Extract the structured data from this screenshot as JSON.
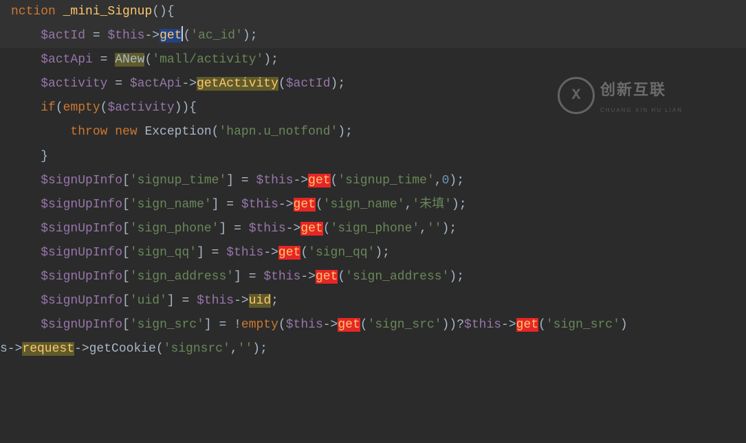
{
  "watermark": {
    "brand": "创新互联",
    "sub": "CHUANG XIN HU LIAN",
    "logoLetter": "X"
  },
  "code": {
    "line0_pre": "nction ",
    "line0_fn": "_mini_Signup",
    "line0_post": "(){",
    "l1_a": "    ",
    "l1_var": "$actId",
    "l1_b": " = ",
    "l1_this": "$this",
    "l1_c": "->",
    "l1_get": "get",
    "l1_d": "(",
    "l1_str": "'ac_id'",
    "l1_e": ");",
    "l2_a": "    ",
    "l2_var": "$actApi",
    "l2_b": " = ",
    "l2_new": "ANew",
    "l2_c": "(",
    "l2_str": "'mall/activity'",
    "l2_d": ");",
    "blank": "",
    "l4_a": "    ",
    "l4_var": "$activity",
    "l4_b": " = ",
    "l4_api": "$actApi",
    "l4_c": "->",
    "l4_meth": "getActivity",
    "l4_d": "(",
    "l4_arg": "$actId",
    "l4_e": ");",
    "l5_a": "    ",
    "l5_if": "if",
    "l5_b": "(",
    "l5_emp": "empty",
    "l5_c": "(",
    "l5_var": "$activity",
    "l5_d": ")){",
    "l6_a": "        ",
    "l6_throw": "throw ",
    "l6_new": "new ",
    "l6_ex": "Exception(",
    "l6_str": "'hapn.u_notfond'",
    "l6_e": ");",
    "l7_a": "    }",
    "l9_a": "    ",
    "l9_v": "$signUpInfo",
    "l9_b": "[",
    "l9_k": "'signup_time'",
    "l9_c": "] = ",
    "l9_t": "$this",
    "l9_d": "->",
    "l9_g": "get",
    "l9_e": "(",
    "l9_s": "'signup_time'",
    "l9_f": ",",
    "l9_n": "0",
    "l9_h": ");",
    "l10_a": "    ",
    "l10_v": "$signUpInfo",
    "l10_b": "[",
    "l10_k": "'sign_name'",
    "l10_c": "] = ",
    "l10_t": "$this",
    "l10_d": "->",
    "l10_g": "get",
    "l10_e": "(",
    "l10_s": "'sign_name'",
    "l10_f": ",",
    "l10_s2": "'未填'",
    "l10_h": ");",
    "l11_a": "    ",
    "l11_v": "$signUpInfo",
    "l11_b": "[",
    "l11_k": "'sign_phone'",
    "l11_c": "] = ",
    "l11_t": "$this",
    "l11_d": "->",
    "l11_g": "get",
    "l11_e": "(",
    "l11_s": "'sign_phone'",
    "l11_f": ",",
    "l11_s2": "''",
    "l11_h": ");",
    "l12_a": "    ",
    "l12_v": "$signUpInfo",
    "l12_b": "[",
    "l12_k": "'sign_qq'",
    "l12_c": "] = ",
    "l12_t": "$this",
    "l12_d": "->",
    "l12_g": "get",
    "l12_e": "(",
    "l12_s": "'sign_qq'",
    "l12_h": ");",
    "l13_a": "    ",
    "l13_v": "$signUpInfo",
    "l13_b": "[",
    "l13_k": "'sign_address'",
    "l13_c": "] = ",
    "l13_t": "$this",
    "l13_d": "->",
    "l13_g": "get",
    "l13_e": "(",
    "l13_s": "'sign_address'",
    "l13_h": ");",
    "l14_a": "    ",
    "l14_v": "$signUpInfo",
    "l14_b": "[",
    "l14_k": "'uid'",
    "l14_c": "] = ",
    "l14_t": "$this",
    "l14_d": "->",
    "l14_u": "uid",
    "l14_e": ";",
    "l15_a": "    ",
    "l15_v": "$signUpInfo",
    "l15_b": "[",
    "l15_k": "'sign_src'",
    "l15_c": "] = !",
    "l15_emp": "empty",
    "l15_d": "(",
    "l15_t1": "$this",
    "l15_e": "->",
    "l15_g1": "get",
    "l15_f": "(",
    "l15_s1": "'sign_src'",
    "l15_h": "))?",
    "l15_t2": "$this",
    "l15_i": "->",
    "l15_g2": "get",
    "l15_j": "(",
    "l15_s2": "'sign_src'",
    "l15_k2": ")",
    "l16_a": "s->",
    "l16_req": "request",
    "l16_b": "->getCookie(",
    "l16_s": "'signsrc'",
    "l16_c": ",",
    "l16_s2": "''",
    "l16_d": ");"
  }
}
